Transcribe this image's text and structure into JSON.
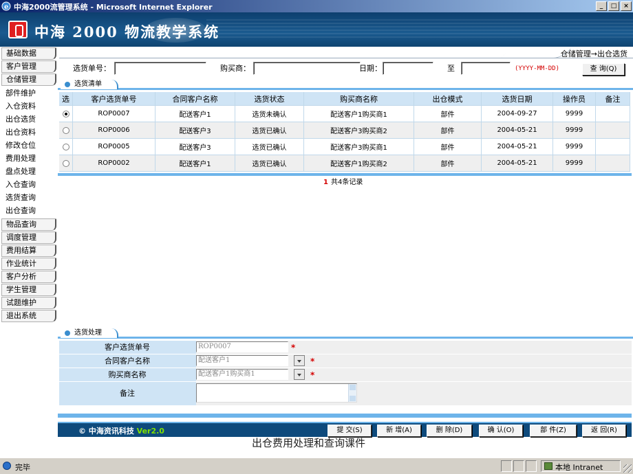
{
  "window": {
    "title": "中海2000流管理系统 - Microsoft Internet Explorer",
    "controls": [
      "_",
      "□",
      "×"
    ]
  },
  "header": {
    "system_title": "中海 2000 物流教学系统"
  },
  "sidebar": {
    "menus": [
      {
        "label": "基础数据"
      },
      {
        "label": "客户管理"
      },
      {
        "label": "仓储管理"
      }
    ],
    "subitems": [
      {
        "label": "部件维护"
      },
      {
        "label": "入仓资料"
      },
      {
        "label": "出仓选货"
      },
      {
        "label": "出仓资料"
      },
      {
        "label": "修改仓位"
      },
      {
        "label": "费用处理"
      },
      {
        "label": "盘点处理"
      },
      {
        "label": "入仓查询"
      },
      {
        "label": "选货查询"
      },
      {
        "label": "出仓查询"
      }
    ],
    "menus_after": [
      {
        "label": "物品查询"
      },
      {
        "label": "调度管理"
      },
      {
        "label": "费用结算"
      },
      {
        "label": "作业统计"
      },
      {
        "label": "客户分析"
      },
      {
        "label": "学生管理"
      },
      {
        "label": "试题维护"
      },
      {
        "label": "退出系统"
      }
    ]
  },
  "breadcrumb": "仓储管理→出仓选货",
  "search": {
    "order_label": "选货单号：",
    "order_value": "",
    "buyer_label": "购买商：",
    "buyer_value": "",
    "date_label": "日期：",
    "date_from": "",
    "to_label": "至",
    "date_to": "",
    "date_hint": "(YYYY-MM-DD)",
    "query_button": "查 询(Q)"
  },
  "list_section": {
    "title": "选货清单"
  },
  "table": {
    "headers": [
      "选",
      "客户选货单号",
      "合同客户名称",
      "选货状态",
      "购买商名称",
      "出仓模式",
      "选货日期",
      "操作员",
      "备注"
    ],
    "rows": [
      {
        "selected": true,
        "order": "ROP0007",
        "customer": "配送客户1",
        "status": "选货未确认",
        "buyer": "配送客户1购买商1",
        "mode": "部件",
        "date": "2004-09-27",
        "operator": "9999",
        "note": ""
      },
      {
        "selected": false,
        "order": "ROP0006",
        "customer": "配送客户3",
        "status": "选货已确认",
        "buyer": "配送客户3购买商2",
        "mode": "部件",
        "date": "2004-05-21",
        "operator": "9999",
        "note": ""
      },
      {
        "selected": false,
        "order": "ROP0005",
        "customer": "配送客户3",
        "status": "选货已确认",
        "buyer": "配送客户3购买商1",
        "mode": "部件",
        "date": "2004-05-21",
        "operator": "9999",
        "note": ""
      },
      {
        "selected": false,
        "order": "ROP0002",
        "customer": "配送客户1",
        "status": "选货已确认",
        "buyer": "配送客户1购买商2",
        "mode": "部件",
        "date": "2004-05-21",
        "operator": "9999",
        "note": ""
      }
    ]
  },
  "pager": {
    "page": "1",
    "summary": "共4条记录"
  },
  "form_section": {
    "title": "选货处理"
  },
  "form": {
    "order_label": "客户选货单号",
    "order_value": "ROP0007",
    "customer_label": "合同客户名称",
    "customer_value": "配送客户1",
    "buyer_label": "购买商名称",
    "buyer_value": "配送客户1购买商1",
    "note_label": "备注",
    "note_value": "",
    "required_mark": "*"
  },
  "footer": {
    "copyright": "© 中海资讯科技 ",
    "version": "Ver2.0",
    "buttons": {
      "submit": "提 交(S)",
      "add": "新 增(A)",
      "delete": "删 除(D)",
      "confirm": "确 认(O)",
      "part": "部 件(Z)",
      "back": "返 回(R)"
    }
  },
  "caption": "出仓费用处理和查询课件",
  "statusbar": {
    "status": "完毕",
    "zone": "本地 Intranet"
  }
}
